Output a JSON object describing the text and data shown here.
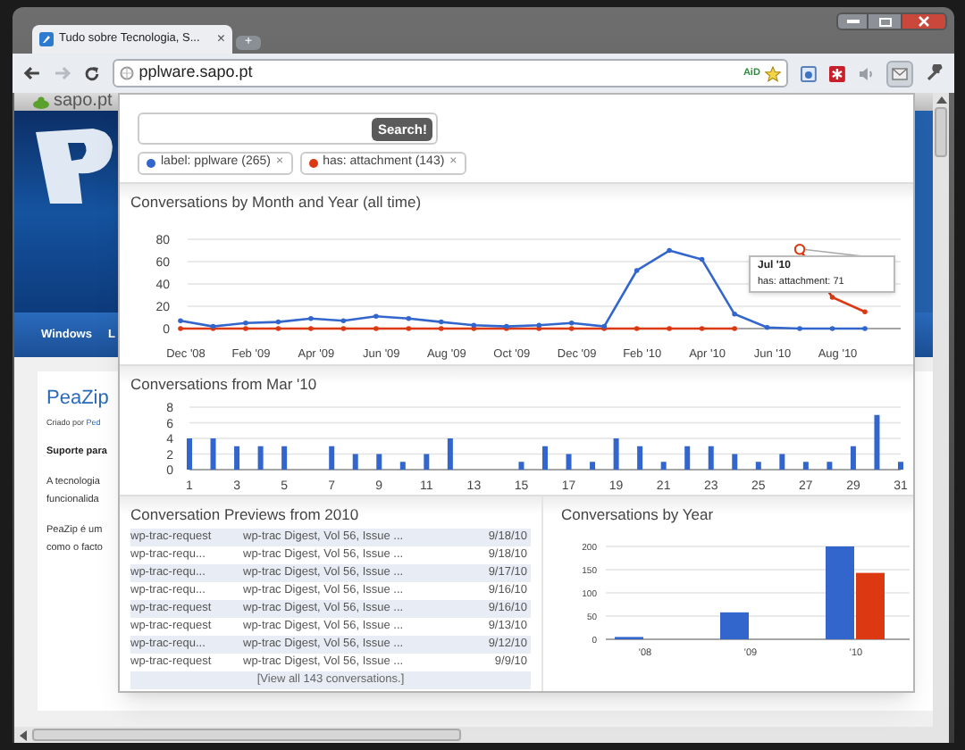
{
  "window": {
    "tab_title": "Tudo sobre Tecnologia, S...",
    "tab_close": "×",
    "new_tab": "+",
    "address": "pplware.sapo.pt",
    "address_badge": "AiD"
  },
  "background_page": {
    "site_bar": "sapo.pt",
    "nav": [
      "Windows",
      "L"
    ],
    "article_title": "PeaZip",
    "byline_label": "Criado por",
    "byline_link": "Ped",
    "lead": "Suporte para",
    "paragraphs": [
      [
        "A tecnologia",
        "funcionalida"
      ],
      [
        "PeaZip é um",
        "como o facto"
      ]
    ]
  },
  "popup": {
    "search": {
      "button": "Search!"
    },
    "filters": [
      {
        "label": "label: pplware (265)",
        "color": "#3366cc",
        "remove": "×"
      },
      {
        "label": "has: attachment (143)",
        "color": "#dc3912",
        "remove": "×"
      }
    ],
    "monthly": {
      "title": "Conversations by Month and Year (all time)",
      "chart_data": {
        "type": "line",
        "categories": [
          "Dec '08",
          null,
          "Feb '09",
          null,
          "Apr '09",
          null,
          "Jun '09",
          null,
          "Aug '09",
          null,
          "Oct '09",
          null,
          "Dec '09",
          null,
          "Feb '10",
          null,
          "Apr '10",
          null,
          "Jun '10",
          null,
          "Aug '10",
          null
        ],
        "series": [
          {
            "color": "#3366cc",
            "values": [
              7,
              2,
              5,
              6,
              9,
              7,
              11,
              9,
              6,
              3,
              2,
              3,
              5,
              2,
              52,
              70,
              62,
              13,
              1,
              0,
              0,
              0
            ]
          },
          {
            "color": "#dc3912",
            "values": [
              0,
              0,
              0,
              0,
              0,
              0,
              0,
              0,
              0,
              0,
              0,
              0,
              0,
              0,
              0,
              0,
              0,
              0,
              null,
              71,
              28,
              15
            ]
          }
        ],
        "ylim": [
          0,
          80
        ],
        "yticks": [
          0,
          20,
          40,
          60,
          80
        ],
        "grid": true
      },
      "tooltip": {
        "title": "Jul '10",
        "text": "has: attachment: 71"
      }
    },
    "daily": {
      "title": "Conversations from Mar '10",
      "chart_data": {
        "type": "bar",
        "x": [
          1,
          2,
          3,
          4,
          5,
          6,
          7,
          8,
          9,
          10,
          11,
          12,
          13,
          14,
          15,
          16,
          17,
          18,
          19,
          20,
          21,
          22,
          23,
          24,
          25,
          26,
          27,
          28,
          29,
          30,
          31
        ],
        "series": [
          {
            "color": "#3366cc",
            "values": [
              4,
              4,
              3,
              3,
              3,
              0,
              3,
              2,
              2,
              1,
              2,
              4,
              0,
              0,
              1,
              3,
              2,
              1,
              4,
              3,
              1,
              3,
              3,
              2,
              1,
              2,
              1,
              1,
              3,
              7,
              1
            ]
          }
        ],
        "xlim": [
          1,
          31
        ],
        "ylim": [
          0,
          8
        ],
        "yticks": [
          0,
          2,
          4,
          6,
          8
        ],
        "xticks": [
          1,
          3,
          5,
          7,
          9,
          11,
          13,
          15,
          17,
          19,
          21,
          23,
          25,
          27,
          29,
          31
        ],
        "grid": true
      }
    },
    "previews": {
      "title": "Conversation Previews from 2010",
      "rows": [
        {
          "sender": "wp-trac-request",
          "subject": "wp-trac Digest, Vol 56, Issue ...",
          "date": "9/18/10"
        },
        {
          "sender": "wp-trac-requ...",
          "subject": "wp-trac Digest, Vol 56, Issue ...",
          "date": "9/18/10"
        },
        {
          "sender": "wp-trac-requ...",
          "subject": "wp-trac Digest, Vol 56, Issue ...",
          "date": "9/17/10"
        },
        {
          "sender": "wp-trac-requ...",
          "subject": "wp-trac Digest, Vol 56, Issue ...",
          "date": "9/16/10"
        },
        {
          "sender": "wp-trac-request",
          "subject": "wp-trac Digest, Vol 56, Issue ...",
          "date": "9/16/10"
        },
        {
          "sender": "wp-trac-request",
          "subject": "wp-trac Digest, Vol 56, Issue ...",
          "date": "9/13/10"
        },
        {
          "sender": "wp-trac-requ...",
          "subject": "wp-trac Digest, Vol 56, Issue ...",
          "date": "9/12/10"
        },
        {
          "sender": "wp-trac-request",
          "subject": "wp-trac Digest, Vol 56, Issue ...",
          "date": "9/9/10"
        }
      ],
      "view_all": "[View all 143 conversations.]"
    },
    "yearly": {
      "title": "Conversations by Year",
      "chart_data": {
        "type": "bar",
        "categories": [
          "'08",
          "'09",
          "'10"
        ],
        "series": [
          {
            "color": "#3366cc",
            "values": [
              5,
              58,
              200
            ]
          },
          {
            "color": "#dc3912",
            "values": [
              0,
              0,
              143
            ]
          }
        ],
        "ylim": [
          0,
          200
        ],
        "yticks": [
          0,
          50,
          100,
          150,
          200
        ],
        "grid": true
      }
    }
  }
}
